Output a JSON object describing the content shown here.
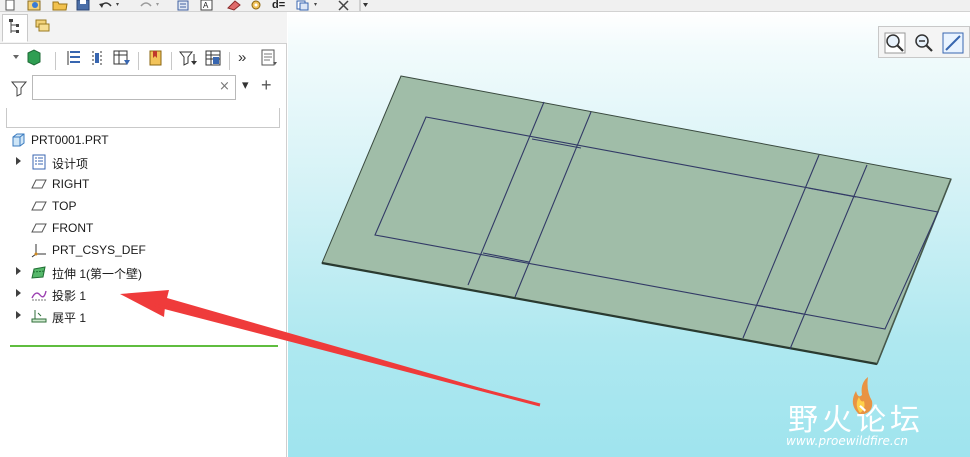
{
  "top_toolbar": {
    "icons": [
      "new-icon",
      "open-icon",
      "open-folder-icon",
      "save-icon",
      "undo-icon",
      "redo-icon",
      "regenerate-icon",
      "text-icon",
      "eraser-icon",
      "settings-icon",
      "dimension-icon",
      "copy-icon",
      "close-window-icon",
      "more-icon"
    ],
    "dimension_label": "d="
  },
  "left_panel": {
    "tabs": [
      "model-tree-tab",
      "layers-tab"
    ],
    "tree_toolbar": [
      "show-icon",
      "tree-list-icon",
      "columns-icon",
      "filter-table-icon",
      "bookmark-icon",
      "sort-filter-icon",
      "table-icon",
      "more-options-icon",
      "notes-icon"
    ],
    "more_label": "»",
    "filter": {
      "value": "",
      "placeholder": ""
    },
    "clear_symbol": "×",
    "dropdown_symbol": "▾",
    "add_symbol": "+",
    "tree": {
      "root": "PRT0001.PRT",
      "items": [
        {
          "label": "设计项",
          "icon": "design-items-icon"
        },
        {
          "label": "RIGHT",
          "icon": "datum-plane-icon"
        },
        {
          "label": "TOP",
          "icon": "datum-plane-icon"
        },
        {
          "label": "FRONT",
          "icon": "datum-plane-icon"
        },
        {
          "label": "PRT_CSYS_DEF",
          "icon": "csys-icon"
        },
        {
          "label": "拉伸 1(第一个壁)",
          "icon": "extrude-wall-icon"
        },
        {
          "label": "投影 1",
          "icon": "projected-curve-icon"
        },
        {
          "label": "展平 1",
          "icon": "flatten-icon"
        }
      ]
    }
  },
  "viewport": {
    "view_tools": [
      "zoom-fit-icon",
      "zoom-out-icon",
      "repaint-icon"
    ],
    "model_color": "#a0bda8",
    "background_bottom": "#9fe4ee",
    "arrow_color": "#ef3b3b"
  },
  "watermark": {
    "title": "野火论坛",
    "url": "www.proewildfire.cn"
  }
}
